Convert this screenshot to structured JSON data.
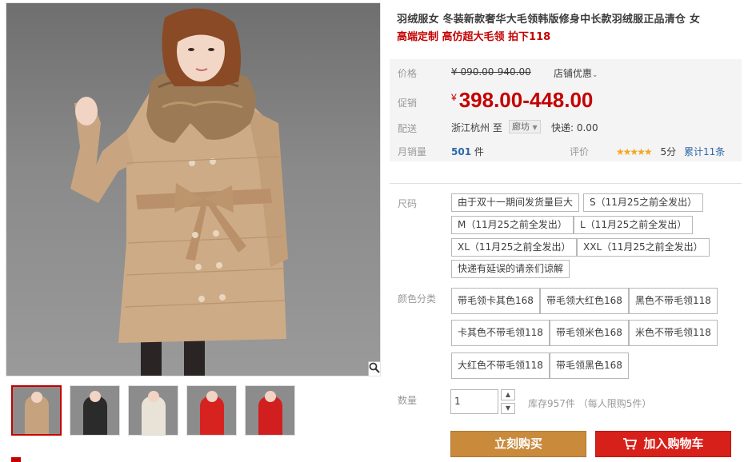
{
  "product": {
    "title": "羽绒服女 冬装新款奢华大毛领韩版修身中长款羽绒服正品清仓 女",
    "subtitle": "高端定制 高仿超大毛领 拍下118"
  },
  "pricing": {
    "price_label": "价格",
    "original_price": "¥ 090.00-940.00",
    "shop_promo": "店铺优惠",
    "promo_label": "促销",
    "currency": "¥",
    "promo_price": "398.00-448.00",
    "delivery_label": "配送",
    "ship_from": "浙江杭州",
    "ship_to_prefix": "至",
    "ship_to": "廊坊",
    "shipping_fee": "快递: 0.00",
    "monthly_sales_label": "月销量",
    "monthly_sales_count": "501",
    "monthly_sales_unit": "件",
    "review_label": "评价",
    "stars": "★★★★★",
    "score": "5分",
    "review_count": "累计11条"
  },
  "size": {
    "label": "尺码",
    "options": [
      "由于双十一期间发货量巨大",
      "S（11月25之前全发出）",
      "M（11月25之前全发出）",
      "L（11月25之前全发出）",
      "XL（11月25之前全发出）",
      "XXL（11月25之前全发出）",
      "快递有延误的请亲们谅解"
    ]
  },
  "color": {
    "label": "颜色分类",
    "options": [
      "带毛领卡其色168",
      "带毛领大红色168",
      "黑色不带毛领118",
      "卡其色不带毛领118",
      "带毛领米色168",
      "米色不带毛领118",
      "大红色不带毛领118",
      "带毛领黑色168"
    ]
  },
  "quantity": {
    "label": "数量",
    "value": "1",
    "stock": "库存957件 （每人限购5件）"
  },
  "actions": {
    "buy_now": "立刻购买",
    "add_to_cart": "加入购物车"
  },
  "gallery": {
    "thumbnail_colors": [
      "#c6a27f",
      "#2b2b2b",
      "#e9e2d6",
      "#d7231f",
      "#d11f1f"
    ]
  },
  "colors": {
    "accent_red": "#c40000",
    "buy_now_bg": "#c98a3c",
    "cart_bg": "#d8201a"
  }
}
